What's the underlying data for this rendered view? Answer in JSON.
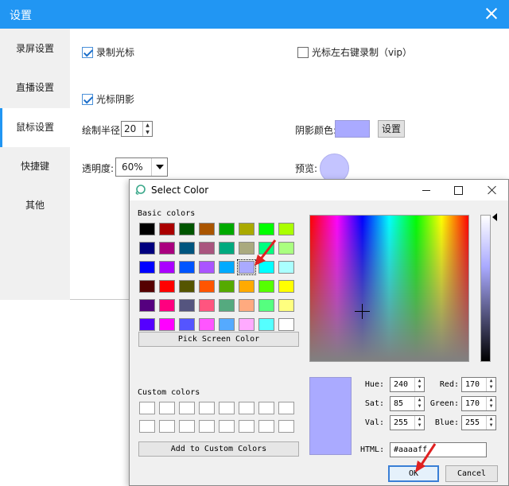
{
  "settings": {
    "title": "设置",
    "sidebar": [
      {
        "label": "录屏设置",
        "active": false
      },
      {
        "label": "直播设置",
        "active": false
      },
      {
        "label": "鼠标设置",
        "active": true
      },
      {
        "label": "快捷键",
        "active": false
      },
      {
        "label": "其他",
        "active": false
      }
    ],
    "record_cursor_label": "录制光标",
    "record_mouse_buttons_label": "光标左右键录制（vip）",
    "cursor_shadow_label": "光标阴影",
    "radius_label": "绘制半径:",
    "radius_value": "20",
    "shadow_color_label": "阴影颜色:",
    "shadow_color": "#aaaaff",
    "set_button": "设置",
    "opacity_label": "透明度:",
    "opacity_value": "60%",
    "preview_label": "预览:"
  },
  "dialog": {
    "title": "Select Color",
    "basic_colors_label": "Basic colors",
    "basic_colors": [
      [
        "#000000",
        "#aa0000",
        "#005500",
        "#aa5500",
        "#00aa00",
        "#aaaa00",
        "#00ff00",
        "#aaff00"
      ],
      [
        "#00007f",
        "#aa007f",
        "#00557f",
        "#aa557f",
        "#00aa7f",
        "#aaaa7f",
        "#00ff7f",
        "#aaff7f"
      ],
      [
        "#0000ff",
        "#aa00ff",
        "#0055ff",
        "#aa55ff",
        "#00aaff",
        "#aaaaff",
        "#00ffff",
        "#aaffff"
      ],
      [
        "#550000",
        "#ff0000",
        "#555500",
        "#ff5500",
        "#55aa00",
        "#ffaa00",
        "#55ff00",
        "#ffff00"
      ],
      [
        "#55007f",
        "#ff007f",
        "#55557f",
        "#ff557f",
        "#55aa7f",
        "#ffaa7f",
        "#55ff7f",
        "#ffff7f"
      ],
      [
        "#5500ff",
        "#ff00ff",
        "#5555ff",
        "#ff55ff",
        "#55aaff",
        "#ffaaff",
        "#55ffff",
        "#ffffff"
      ]
    ],
    "selected_basic": [
      2,
      5
    ],
    "pick_screen_button": "Pick Screen Color",
    "custom_colors_label": "Custom colors",
    "add_custom_button": "Add to Custom Colors",
    "hue_label": "Hue:",
    "hue": "240",
    "sat_label": "Sat:",
    "sat": "85",
    "val_label": "Val:",
    "val": "255",
    "red_label": "Red:",
    "red": "170",
    "green_label": "Green:",
    "green": "170",
    "blue_label": "Blue:",
    "blue": "255",
    "html_label": "HTML:",
    "html_value": "#aaaaff",
    "ok_button": "OK",
    "cancel_button": "Cancel"
  }
}
